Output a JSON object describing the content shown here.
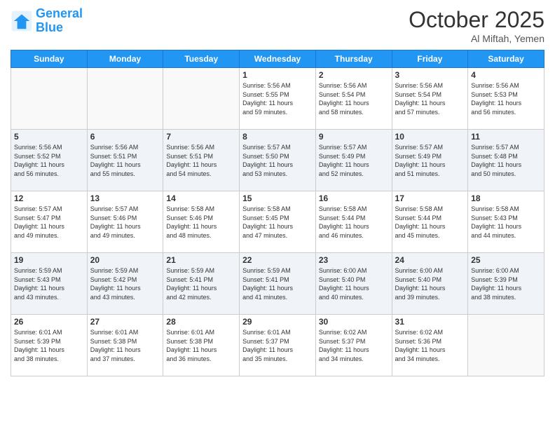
{
  "logo": {
    "line1": "General",
    "line2": "Blue"
  },
  "header": {
    "month": "October 2025",
    "location": "Al Miftah, Yemen"
  },
  "days": [
    "Sunday",
    "Monday",
    "Tuesday",
    "Wednesday",
    "Thursday",
    "Friday",
    "Saturday"
  ],
  "weeks": [
    [
      {
        "day": "",
        "info": ""
      },
      {
        "day": "",
        "info": ""
      },
      {
        "day": "",
        "info": ""
      },
      {
        "day": "1",
        "info": "Sunrise: 5:56 AM\nSunset: 5:55 PM\nDaylight: 11 hours\nand 59 minutes."
      },
      {
        "day": "2",
        "info": "Sunrise: 5:56 AM\nSunset: 5:54 PM\nDaylight: 11 hours\nand 58 minutes."
      },
      {
        "day": "3",
        "info": "Sunrise: 5:56 AM\nSunset: 5:54 PM\nDaylight: 11 hours\nand 57 minutes."
      },
      {
        "day": "4",
        "info": "Sunrise: 5:56 AM\nSunset: 5:53 PM\nDaylight: 11 hours\nand 56 minutes."
      }
    ],
    [
      {
        "day": "5",
        "info": "Sunrise: 5:56 AM\nSunset: 5:52 PM\nDaylight: 11 hours\nand 56 minutes."
      },
      {
        "day": "6",
        "info": "Sunrise: 5:56 AM\nSunset: 5:51 PM\nDaylight: 11 hours\nand 55 minutes."
      },
      {
        "day": "7",
        "info": "Sunrise: 5:56 AM\nSunset: 5:51 PM\nDaylight: 11 hours\nand 54 minutes."
      },
      {
        "day": "8",
        "info": "Sunrise: 5:57 AM\nSunset: 5:50 PM\nDaylight: 11 hours\nand 53 minutes."
      },
      {
        "day": "9",
        "info": "Sunrise: 5:57 AM\nSunset: 5:49 PM\nDaylight: 11 hours\nand 52 minutes."
      },
      {
        "day": "10",
        "info": "Sunrise: 5:57 AM\nSunset: 5:49 PM\nDaylight: 11 hours\nand 51 minutes."
      },
      {
        "day": "11",
        "info": "Sunrise: 5:57 AM\nSunset: 5:48 PM\nDaylight: 11 hours\nand 50 minutes."
      }
    ],
    [
      {
        "day": "12",
        "info": "Sunrise: 5:57 AM\nSunset: 5:47 PM\nDaylight: 11 hours\nand 49 minutes."
      },
      {
        "day": "13",
        "info": "Sunrise: 5:57 AM\nSunset: 5:46 PM\nDaylight: 11 hours\nand 49 minutes."
      },
      {
        "day": "14",
        "info": "Sunrise: 5:58 AM\nSunset: 5:46 PM\nDaylight: 11 hours\nand 48 minutes."
      },
      {
        "day": "15",
        "info": "Sunrise: 5:58 AM\nSunset: 5:45 PM\nDaylight: 11 hours\nand 47 minutes."
      },
      {
        "day": "16",
        "info": "Sunrise: 5:58 AM\nSunset: 5:44 PM\nDaylight: 11 hours\nand 46 minutes."
      },
      {
        "day": "17",
        "info": "Sunrise: 5:58 AM\nSunset: 5:44 PM\nDaylight: 11 hours\nand 45 minutes."
      },
      {
        "day": "18",
        "info": "Sunrise: 5:58 AM\nSunset: 5:43 PM\nDaylight: 11 hours\nand 44 minutes."
      }
    ],
    [
      {
        "day": "19",
        "info": "Sunrise: 5:59 AM\nSunset: 5:43 PM\nDaylight: 11 hours\nand 43 minutes."
      },
      {
        "day": "20",
        "info": "Sunrise: 5:59 AM\nSunset: 5:42 PM\nDaylight: 11 hours\nand 43 minutes."
      },
      {
        "day": "21",
        "info": "Sunrise: 5:59 AM\nSunset: 5:41 PM\nDaylight: 11 hours\nand 42 minutes."
      },
      {
        "day": "22",
        "info": "Sunrise: 5:59 AM\nSunset: 5:41 PM\nDaylight: 11 hours\nand 41 minutes."
      },
      {
        "day": "23",
        "info": "Sunrise: 6:00 AM\nSunset: 5:40 PM\nDaylight: 11 hours\nand 40 minutes."
      },
      {
        "day": "24",
        "info": "Sunrise: 6:00 AM\nSunset: 5:40 PM\nDaylight: 11 hours\nand 39 minutes."
      },
      {
        "day": "25",
        "info": "Sunrise: 6:00 AM\nSunset: 5:39 PM\nDaylight: 11 hours\nand 38 minutes."
      }
    ],
    [
      {
        "day": "26",
        "info": "Sunrise: 6:01 AM\nSunset: 5:39 PM\nDaylight: 11 hours\nand 38 minutes."
      },
      {
        "day": "27",
        "info": "Sunrise: 6:01 AM\nSunset: 5:38 PM\nDaylight: 11 hours\nand 37 minutes."
      },
      {
        "day": "28",
        "info": "Sunrise: 6:01 AM\nSunset: 5:38 PM\nDaylight: 11 hours\nand 36 minutes."
      },
      {
        "day": "29",
        "info": "Sunrise: 6:01 AM\nSunset: 5:37 PM\nDaylight: 11 hours\nand 35 minutes."
      },
      {
        "day": "30",
        "info": "Sunrise: 6:02 AM\nSunset: 5:37 PM\nDaylight: 11 hours\nand 34 minutes."
      },
      {
        "day": "31",
        "info": "Sunrise: 6:02 AM\nSunset: 5:36 PM\nDaylight: 11 hours\nand 34 minutes."
      },
      {
        "day": "",
        "info": ""
      }
    ]
  ]
}
